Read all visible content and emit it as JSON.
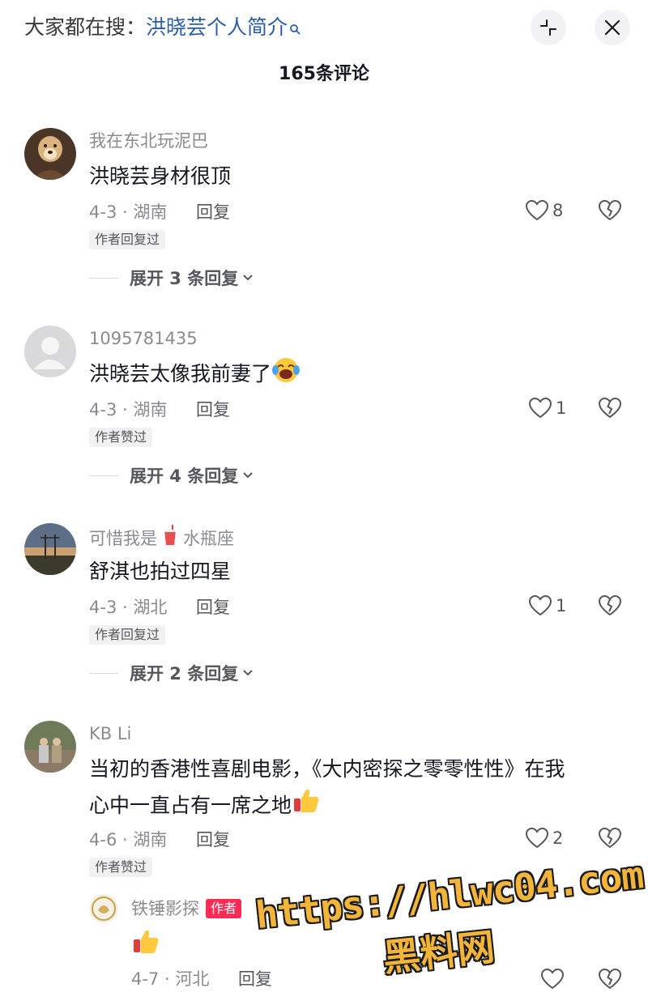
{
  "header": {
    "search_prefix": "大家都在搜：",
    "search_keyword": "洪晓芸个人简介",
    "comment_count": "165条评论"
  },
  "comments": [
    {
      "username": "我在东北玩泥巴",
      "text": "洪晓芸身材很顶",
      "date_location": "4-3 · 湖南",
      "reply_label": "回复",
      "likes": "8",
      "badge": "作者回复过",
      "expand": "展开 3 条回复"
    },
    {
      "username": "1095781435",
      "text": "洪晓芸太像我前妻了",
      "date_location": "4-3 · 湖南",
      "reply_label": "回复",
      "likes": "1",
      "badge": "作者赞过",
      "expand": "展开 4 条回复"
    },
    {
      "username": "可惜我是",
      "username_suffix": "水瓶座",
      "text": "舒淇也拍过四星",
      "date_location": "4-3 · 湖北",
      "reply_label": "回复",
      "likes": "1",
      "badge": "作者回复过",
      "expand": "展开 2 条回复"
    },
    {
      "username": "KB Li",
      "text_line1": "当初的香港性喜剧电影，《大内密探之零零性性》在我",
      "text_line2": "心中一直占有一席之地",
      "date_location": "4-6 · 湖南",
      "reply_label": "回复",
      "likes": "2",
      "badge": "作者赞过"
    }
  ],
  "reply": {
    "username": "铁锤影探",
    "author_tag": "作者",
    "date_location": "4-7 · 河北",
    "reply_label": "回复"
  },
  "watermark": {
    "url": "https://hlwc04.com",
    "name": "黑料网"
  },
  "colors": {
    "keyword_blue": "#2a5ca8",
    "author_red": "#fe2c55",
    "watermark_yellow": "#f2b53a"
  }
}
